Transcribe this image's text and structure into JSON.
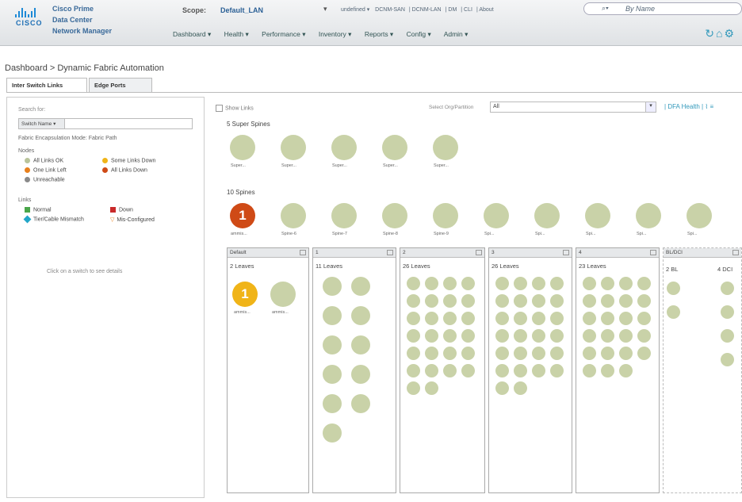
{
  "header": {
    "product_line1": "Cisco Prime",
    "product_line2": "Data Center",
    "product_line3": "Network Manager",
    "logo_text": "CISCO",
    "scope_label": "Scope:",
    "scope_value": "Default_LAN",
    "scope_caret": "▾",
    "top_links": [
      "undefined ▾",
      "DCNM-SAN",
      "DCNM-LAN",
      "DM",
      "CLI",
      "About"
    ],
    "search_placeholder": "By Name",
    "nav": [
      "Dashboard ▾",
      "Health ▾",
      "Performance ▾",
      "Inventory ▾",
      "Reports ▾",
      "Config ▾",
      "Admin ▾"
    ]
  },
  "breadcrumb": "Dashboard > Dynamic Fabric Automation",
  "tabs": [
    "Inter Switch Links",
    "Edge Ports"
  ],
  "left": {
    "search_label": "Search for:",
    "search_type": "Switch Name",
    "encap_label": "Fabric Encapsulation Mode:",
    "encap_value": "Fabric Path",
    "nodes_label": "Nodes",
    "nodes_legend": [
      {
        "label": "All Links OK",
        "color": "#b9c49b"
      },
      {
        "label": "Some Links Down",
        "color": "#f0b418"
      },
      {
        "label": "One Link Left",
        "color": "#e8801c"
      },
      {
        "label": "All Links Down",
        "color": "#cf4a16"
      },
      {
        "label": "Unreachable",
        "color": "#8a8a8a"
      }
    ],
    "links_label": "Links",
    "links_legend": [
      {
        "label": "Normal",
        "color": "#4aa64a"
      },
      {
        "label": "Down",
        "color": "#c92a2a"
      },
      {
        "label": "Tier/Cable Mismatch",
        "color": "#22a6c8"
      },
      {
        "label": "Mis-Configured",
        "color": "#e8801c"
      }
    ],
    "hint": "Click on a switch to see details"
  },
  "right": {
    "show_links": "Show Links",
    "org_label": "Select Org/Partition",
    "org_value": "All",
    "health_link": "DFA Health",
    "super_spines_title": "5 Super Spines",
    "super_spine_labels": [
      "Super...",
      "Super...",
      "Super...",
      "Super...",
      "Super..."
    ],
    "spines_title": "10 Spines",
    "spine_labels": [
      "ammis...",
      "Spine-6",
      "Spine-7",
      "Spine-8",
      "Spine-9",
      "Spi...",
      "Spi...",
      "Spi...",
      "Spi...",
      "Spi..."
    ],
    "spine_alert_badge": "1",
    "panes": [
      {
        "header": "Default",
        "count": "2 Leaves",
        "leaf_badge": "1",
        "leaf_labels": [
          "ammis...",
          "ammis..."
        ]
      },
      {
        "header": "1",
        "count": "11 Leaves"
      },
      {
        "header": "2",
        "count": "26 Leaves"
      },
      {
        "header": "3",
        "count": "26 Leaves"
      },
      {
        "header": "4",
        "count": "23 Leaves"
      },
      {
        "header": "BL/DCI",
        "count_bl": "2 BL",
        "count_dci": "4 DCI"
      }
    ]
  }
}
